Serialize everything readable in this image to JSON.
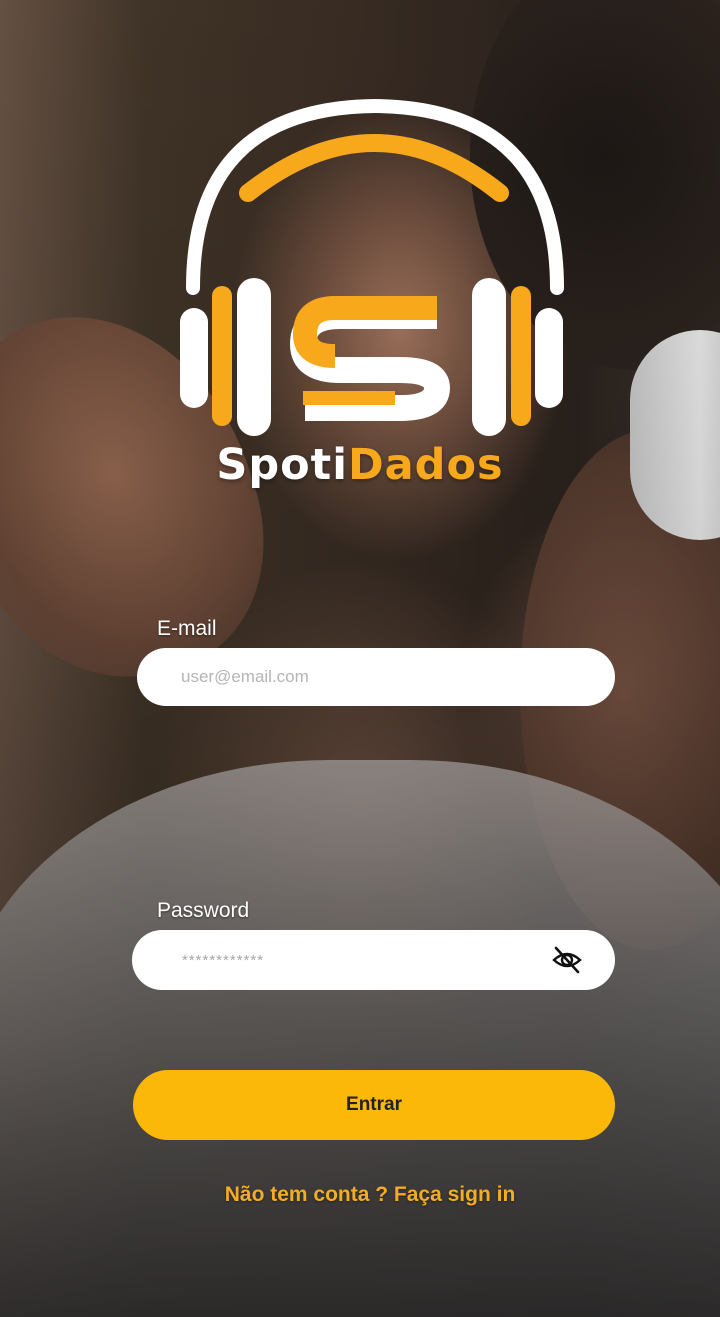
{
  "brand": {
    "name_part1": "Spoti",
    "name_part2": "Dados",
    "logo_letter": "S"
  },
  "colors": {
    "accent": "#fbb809",
    "brand_orange": "#f7a81b",
    "white": "#ffffff"
  },
  "email": {
    "label": "E-mail",
    "placeholder": "user@email.com"
  },
  "password": {
    "label": "Password",
    "masked_value": "************",
    "toggle_icon": "eye-off-icon"
  },
  "actions": {
    "login_label": "Entrar",
    "signup_link": "Não tem conta ? Faça sign in"
  }
}
